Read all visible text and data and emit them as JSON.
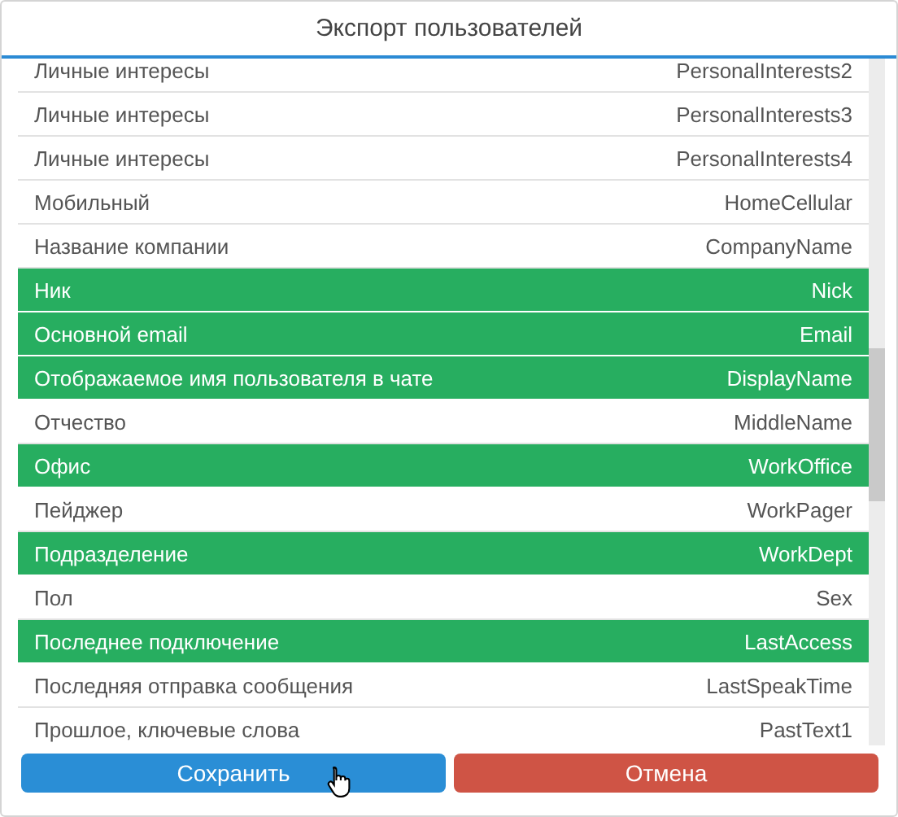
{
  "dialog": {
    "title": "Экспорт пользователей"
  },
  "fields": [
    {
      "label": "Личные интересы",
      "key": "PersonalInterests2",
      "selected": false
    },
    {
      "label": "Личные интересы",
      "key": "PersonalInterests3",
      "selected": false
    },
    {
      "label": "Личные интересы",
      "key": "PersonalInterests4",
      "selected": false
    },
    {
      "label": "Мобильный",
      "key": "HomeCellular",
      "selected": false
    },
    {
      "label": "Название компании",
      "key": "CompanyName",
      "selected": false
    },
    {
      "label": "Ник",
      "key": "Nick",
      "selected": true
    },
    {
      "label": "Основной email",
      "key": "Email",
      "selected": true
    },
    {
      "label": "Отображаемое имя пользователя в чате",
      "key": "DisplayName",
      "selected": true
    },
    {
      "label": "Отчество",
      "key": "MiddleName",
      "selected": false
    },
    {
      "label": "Офис",
      "key": "WorkOffice",
      "selected": true
    },
    {
      "label": "Пейджер",
      "key": "WorkPager",
      "selected": false
    },
    {
      "label": "Подразделение",
      "key": "WorkDept",
      "selected": true
    },
    {
      "label": "Пол",
      "key": "Sex",
      "selected": false
    },
    {
      "label": "Последнее подключение",
      "key": "LastAccess",
      "selected": true
    },
    {
      "label": "Последняя отправка сообщения",
      "key": "LastSpeakTime",
      "selected": false
    },
    {
      "label": "Прошлое, ключевые слова",
      "key": "PastText1",
      "selected": false
    }
  ],
  "buttons": [
    {
      "label": "Сохранить",
      "kind": "primary"
    },
    {
      "label": "Отмена",
      "kind": "danger"
    }
  ]
}
